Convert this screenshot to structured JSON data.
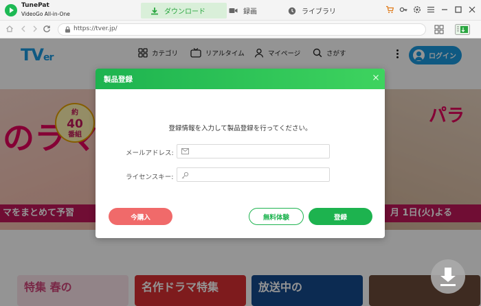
{
  "app": {
    "name": "TunePat",
    "subtitle": "VideoGo All-in-One"
  },
  "tabs": [
    {
      "label": "ダウンロード",
      "icon": "download-icon",
      "active": true
    },
    {
      "label": "録画",
      "icon": "camera-icon",
      "active": false
    },
    {
      "label": "ライブラリ",
      "icon": "clock-icon",
      "active": false
    }
  ],
  "address": {
    "url": "https://tver.jp/"
  },
  "site": {
    "logo_main": "TV",
    "logo_small": "er",
    "nav": [
      {
        "label": "カテゴリ",
        "icon": "grid-icon"
      },
      {
        "label": "リアルタイム",
        "icon": "tv-icon"
      },
      {
        "label": "マイページ",
        "icon": "user-icon"
      },
      {
        "label": "さがす",
        "icon": "search-icon"
      }
    ],
    "login_label": "ログイン",
    "hero_left_text": "のラマ",
    "hero_left_band": "マをまとめて予習",
    "hero_badge_small": "約",
    "hero_badge_big": "40",
    "hero_badge_unit": "番組",
    "hero_right_title": "パラ",
    "hero_right_band": "月 1日(火)よる",
    "cards": [
      {
        "text": "特集 春の"
      },
      {
        "text": "名作ドラマ特集"
      },
      {
        "text": "放送中の"
      },
      {
        "text": ""
      }
    ]
  },
  "modal": {
    "title": "製品登録",
    "message": "登録情報を入力して製品登録を行ってください。",
    "email_label": "メールアドレス:",
    "email_value": "",
    "license_label": "ライセンスキー:",
    "license_value": "",
    "buy_label": "今購入",
    "trial_label": "無料体験",
    "register_label": "登録"
  },
  "colors": {
    "accent_green": "#1db34f",
    "buy_red": "#f06a6a",
    "tver_blue": "#1a9ae0"
  }
}
